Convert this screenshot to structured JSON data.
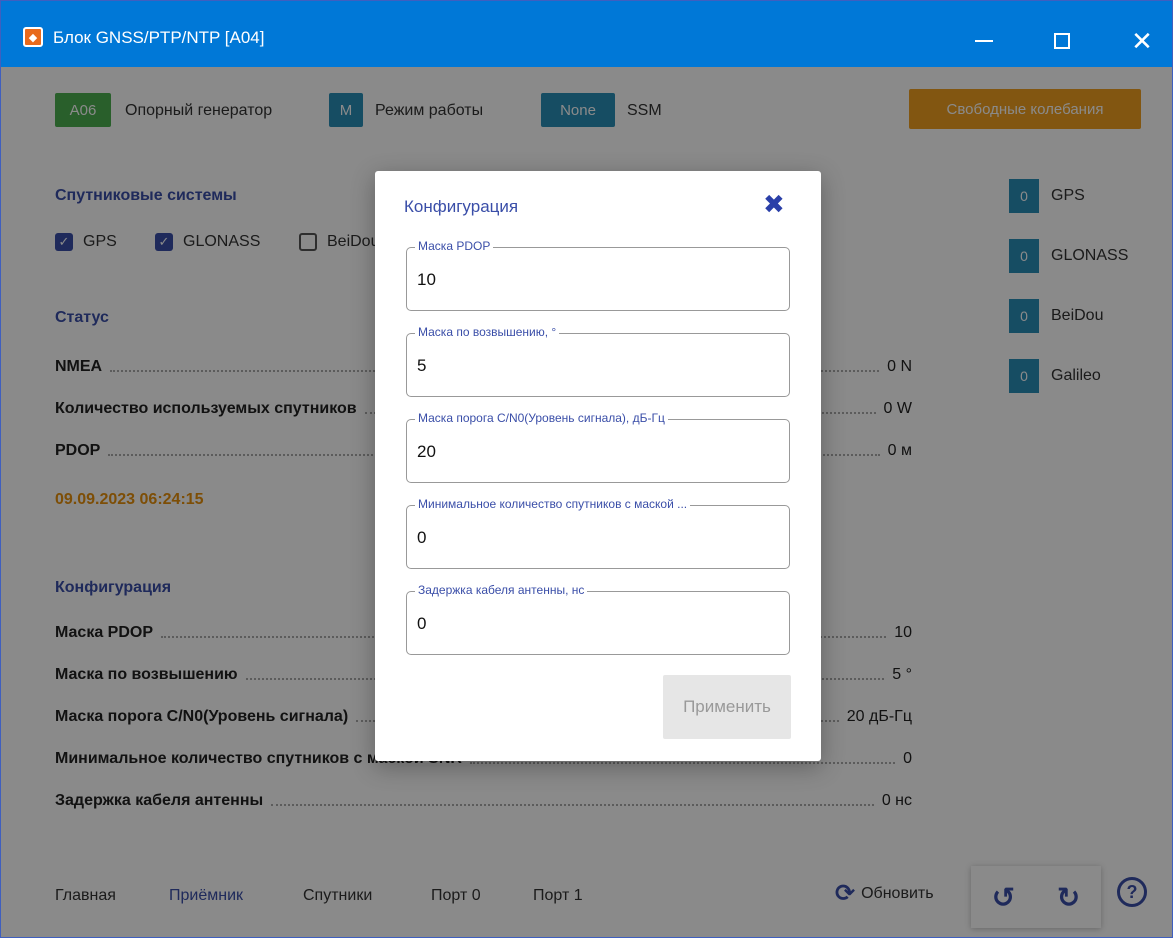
{
  "window": {
    "title": "Блок GNSS/PTP/NTP [A04]",
    "close_glyph": "✕",
    "accent": "#0078d7"
  },
  "header": {
    "ref_gen_badge": "A06",
    "ref_gen_label": "Опорный генератор",
    "mode_badge": "M",
    "mode_label": "Режим работы",
    "ssm_badge": "None",
    "ssm_label": "SSM",
    "state_button": "Свободные колебания"
  },
  "satellite_systems": {
    "title": "Спутниковые системы",
    "items": [
      {
        "label": "GPS",
        "checked": true
      },
      {
        "label": "GLONASS",
        "checked": true
      },
      {
        "label": "BeiDou",
        "checked": false
      }
    ]
  },
  "status": {
    "title": "Статус",
    "rows": [
      {
        "label": "NMEA",
        "value": "0 N"
      },
      {
        "label": "Количество используемых спутников",
        "value": "0 W"
      },
      {
        "label": "PDOP",
        "value": "0 м"
      }
    ],
    "timestamp": "09.09.2023 06:24:15"
  },
  "configuration": {
    "title": "Конфигурация",
    "rows": [
      {
        "label": "Маска PDOP",
        "value": "10"
      },
      {
        "label": "Маска по возвышению",
        "value": "5 °"
      },
      {
        "label": "Маска порога C/N0(Уровень сигнала)",
        "value": "20 дБ-Гц"
      },
      {
        "label": "Минимальное количество спутников с маской SNR",
        "value": "0"
      },
      {
        "label": "Задержка кабеля антенны",
        "value": "0 нс"
      }
    ]
  },
  "satellite_counts": [
    {
      "name": "GPS",
      "count": "0"
    },
    {
      "name": "GLONASS",
      "count": "0"
    },
    {
      "name": "BeiDou",
      "count": "0"
    },
    {
      "name": "Galileo",
      "count": "0"
    }
  ],
  "nav": {
    "items": [
      "Главная",
      "Приёмник",
      "Спутники",
      "Порт 0",
      "Порт 1"
    ],
    "active_index": 1,
    "refresh_label": "Обновить",
    "help_glyph": "?"
  },
  "dialog": {
    "title": "Конфигурация",
    "close_glyph": "✖",
    "fields": [
      {
        "label": "Маска PDOP",
        "value": "10"
      },
      {
        "label": "Маска по возвышению, °",
        "value": "5"
      },
      {
        "label": "Маска порога C/N0(Уровень сигнала), дБ-Гц",
        "value": "20"
      },
      {
        "label": "Минимальное количество спутников с маской ...",
        "value": "0"
      },
      {
        "label": "Задержка кабеля антенны, нс",
        "value": "0"
      }
    ],
    "apply_label": "Применить"
  }
}
